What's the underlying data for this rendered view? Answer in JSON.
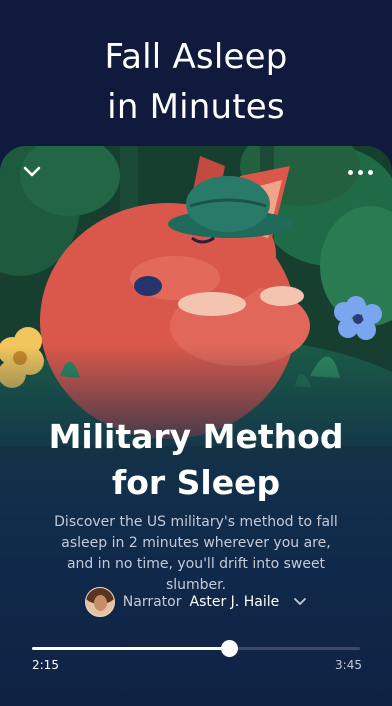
{
  "promo": {
    "headline": "Fall Asleep\nin Minutes"
  },
  "player": {
    "title": "Military Method\nfor Sleep",
    "description": "Discover the US military's method to fall asleep in 2 minutes wherever you are, and in no time, you'll drift into sweet slumber.",
    "narrator_label": "Narrator",
    "narrator_name": "Aster J. Haile",
    "elapsed": "2:15",
    "total": "3:45",
    "progress": 0.6
  },
  "colors": {
    "background": "#0f1a3c",
    "accent": "#ffffff",
    "fox": "#d9584b",
    "hat": "#2a7a6a"
  },
  "icons": [
    "chevron-down-icon",
    "more-options-icon",
    "dropdown-chevron-icon"
  ]
}
